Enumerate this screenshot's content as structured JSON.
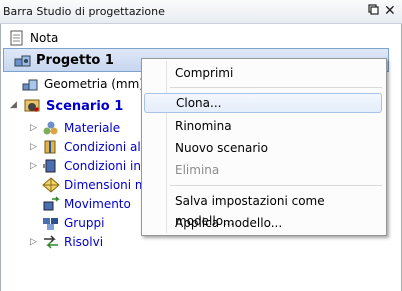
{
  "panel": {
    "title": "Barra Studio di progettazione",
    "pin_icon": "pin-icon",
    "close_label": "✕"
  },
  "tree": {
    "note": "Nota",
    "project": "Progetto 1",
    "geometry": "Geometria (mm)",
    "scenario": "Scenario 1",
    "children": [
      {
        "label": "Materiale",
        "icon": "material-icon"
      },
      {
        "label": "Condizioni al",
        "icon": "boundary-icon"
      },
      {
        "label": "Condizioni in",
        "icon": "initial-icon"
      },
      {
        "label": "Dimensioni m",
        "icon": "mesh-icon"
      },
      {
        "label": "Movimento",
        "icon": "motion-icon"
      },
      {
        "label": "Gruppi",
        "icon": "groups-icon"
      },
      {
        "label": "Risolvi",
        "icon": "solve-icon"
      }
    ]
  },
  "context_menu": {
    "items": [
      {
        "label": "Comprimi",
        "enabled": true
      },
      {
        "label": "Clona...",
        "enabled": true,
        "hovered": true
      },
      {
        "label": "Rinomina",
        "enabled": true
      },
      {
        "label": "Nuovo scenario",
        "enabled": true
      },
      {
        "label": "Elimina",
        "enabled": false
      },
      {
        "label": "Salva impostazioni come modello...",
        "enabled": true
      },
      {
        "label": "Applica modello...",
        "enabled": true
      }
    ]
  },
  "colors": {
    "accent": "#0000cc",
    "selection": "#c7d7f0",
    "disabled": "#8c8c8c"
  }
}
